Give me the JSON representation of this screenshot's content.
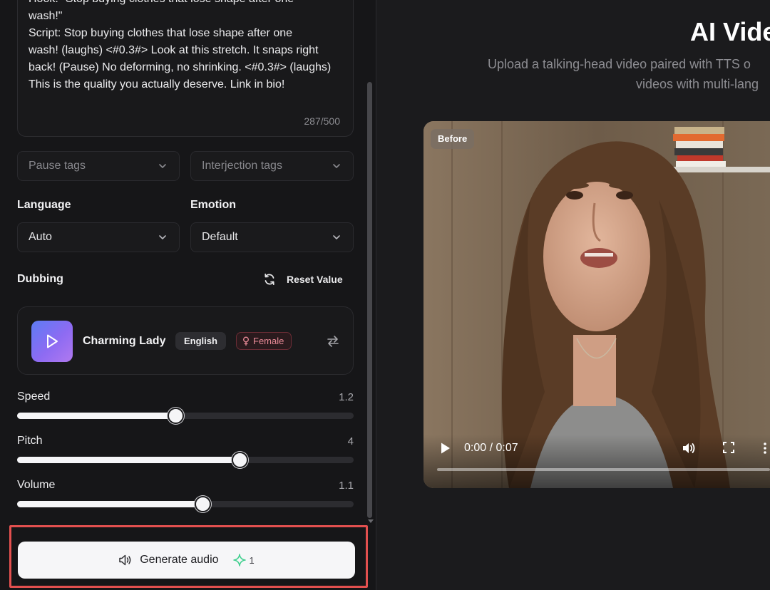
{
  "script_editor": {
    "text": "Hook: \"Stop buying clothes that lose shape after one\nwash!\"\nScript: Stop buying clothes that lose shape after one\nwash! (laughs) <#0.3#> Look at this stretch. It snaps right\nback! (Pause) No deforming, no shrinking. <#0.3#> (laughs)\nThis is the quality you actually deserve. Link in bio!",
    "char_count": "287/500"
  },
  "tag_dropdowns": {
    "pause_placeholder": "Pause tags",
    "interjection_placeholder": "Interjection tags"
  },
  "language": {
    "label": "Language",
    "value": "Auto"
  },
  "emotion": {
    "label": "Emotion",
    "value": "Default"
  },
  "dubbing": {
    "label": "Dubbing",
    "reset_label": "Reset Value",
    "voice": {
      "name": "Charming Lady",
      "language_tag": "English",
      "gender_tag": "Female"
    }
  },
  "sliders": {
    "speed": {
      "label": "Speed",
      "value": "1.2",
      "fraction": 0.47
    },
    "pitch": {
      "label": "Pitch",
      "value": "4",
      "fraction": 0.66
    },
    "volume": {
      "label": "Volume",
      "value": "1.1",
      "fraction": 0.55
    }
  },
  "generate": {
    "label": "Generate audio",
    "cost": "1"
  },
  "hero": {
    "title": "AI Vide",
    "subtitle_line1": "Upload a talking-head video paired with TTS o",
    "subtitle_line2": "videos with multi-lang"
  },
  "video": {
    "badge": "Before",
    "time": "0:00 / 0:07"
  },
  "colors": {
    "highlight": "#e3504f",
    "avatar_gradient_start": "#5d7cf5",
    "avatar_gradient_end": "#b079f0",
    "female_tag": "#ea8b98",
    "sparkle": "#3fcf8e"
  }
}
